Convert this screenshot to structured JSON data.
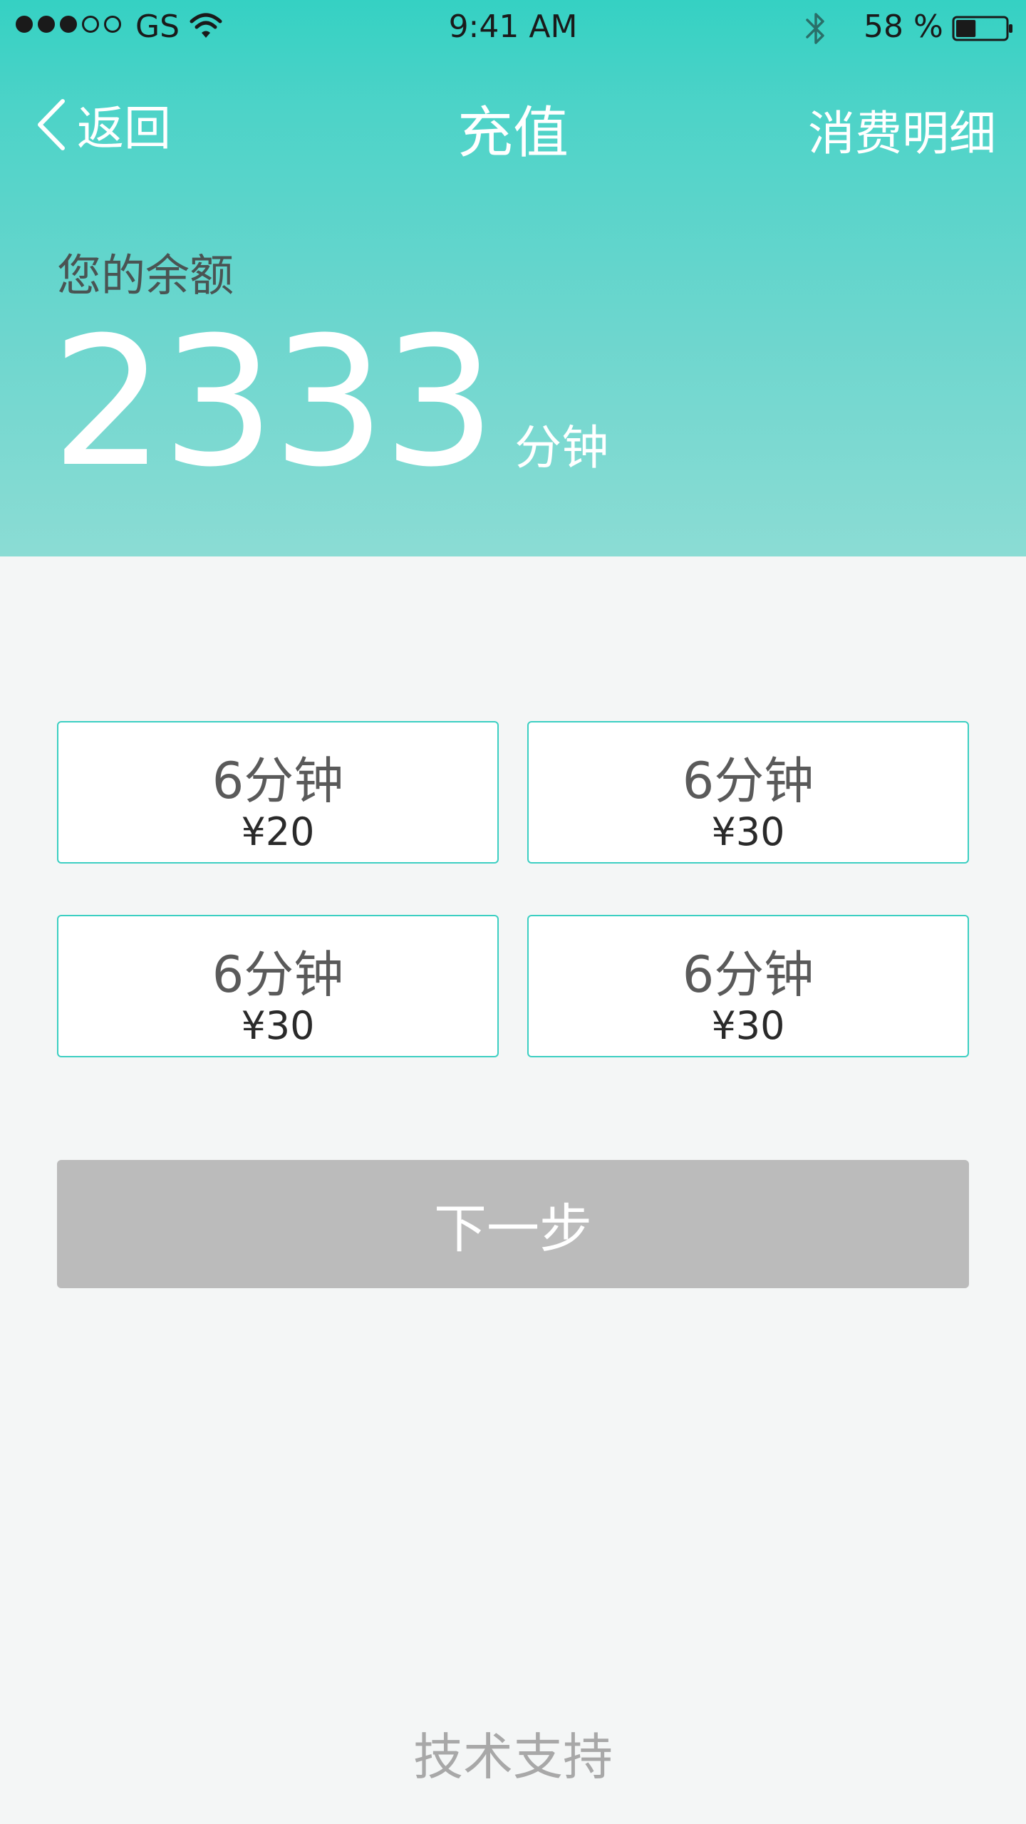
{
  "status_bar": {
    "carrier": "GS",
    "time": "9:41 AM",
    "battery": "58 %",
    "battery_level": 0.4,
    "signal_filled": 3,
    "signal_total": 5,
    "icons": [
      "wifi-icon",
      "bluetooth-icon",
      "battery-icon"
    ]
  },
  "nav": {
    "back_label": "返回",
    "title": "充值",
    "right_label": "消费明细"
  },
  "balance": {
    "label": "您的余额",
    "value": "2333",
    "unit": "分钟"
  },
  "options": [
    {
      "minutes": "6分钟",
      "price": "¥20"
    },
    {
      "minutes": "6分钟",
      "price": "¥30"
    },
    {
      "minutes": "6分钟",
      "price": "¥30"
    },
    {
      "minutes": "6分钟",
      "price": "¥30"
    }
  ],
  "next_button": "下一步",
  "footer": "技术支持",
  "colors": {
    "accent": "#3ccfc2",
    "header_top": "#35d1c3",
    "header_bottom": "#8bdcd4",
    "button_disabled": "#bbbbbb",
    "background": "#f4f6f6"
  }
}
